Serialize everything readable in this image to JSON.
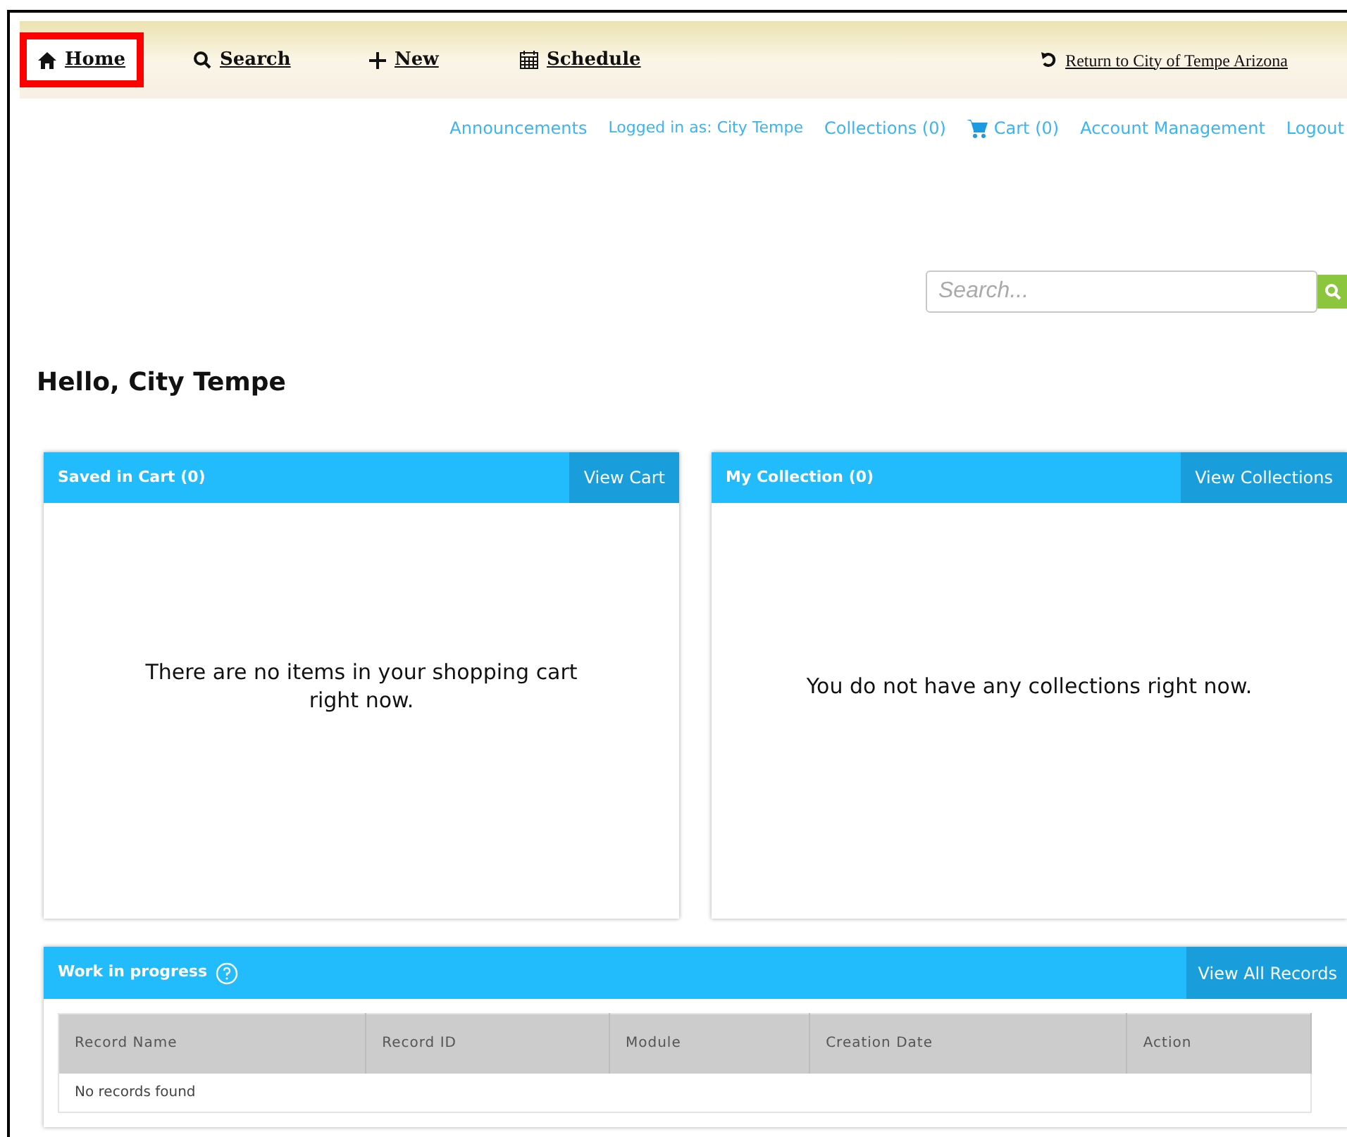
{
  "nav": {
    "items": [
      {
        "label": "Home",
        "kind": "home",
        "highlighted": true
      },
      {
        "label": "Search",
        "kind": "search",
        "highlighted": false
      },
      {
        "label": "New",
        "kind": "new",
        "highlighted": false
      },
      {
        "label": "Schedule",
        "kind": "schedule",
        "highlighted": false
      }
    ],
    "return_link": "Return to City of Tempe Arizona"
  },
  "user_links": [
    {
      "label": "Announcements",
      "kind": "link"
    },
    {
      "label": "Logged in as:  City Tempe",
      "kind": "text"
    },
    {
      "label": "Collections (0)",
      "kind": "link"
    },
    {
      "label": "Cart (0)",
      "kind": "cart"
    },
    {
      "label": "Account Management",
      "kind": "link"
    },
    {
      "label": "Logout",
      "kind": "link"
    }
  ],
  "search": {
    "placeholder": "Search..."
  },
  "greeting": "Hello, City Tempe",
  "cards": [
    {
      "title": "Saved in Cart (0)",
      "action": "View Cart",
      "message": "There are no items in your shopping cart right now."
    },
    {
      "title": "My Collection (0)",
      "action": "View Collections",
      "message": "You do not have any collections right now."
    }
  ],
  "work_in_progress": {
    "title": "Work in progress",
    "action": "View All Records",
    "columns": [
      "Record Name",
      "Record ID",
      "Module",
      "Creation Date",
      "Action"
    ],
    "empty_message": "No records found"
  }
}
